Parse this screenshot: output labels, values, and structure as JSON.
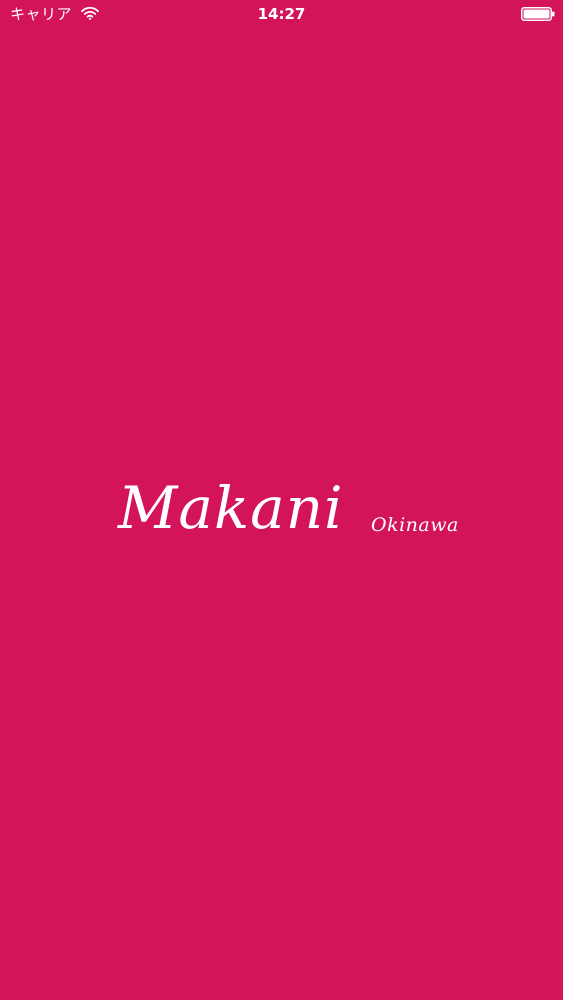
{
  "status_bar": {
    "carrier": "キャリア",
    "time": "14:27",
    "icons": [
      "wifi-icon",
      "battery-icon"
    ]
  },
  "logo": {
    "title": "Makani",
    "subtitle": "Okinawa"
  },
  "colors": {
    "background": "#d3145a",
    "foreground": "#ffffff"
  }
}
